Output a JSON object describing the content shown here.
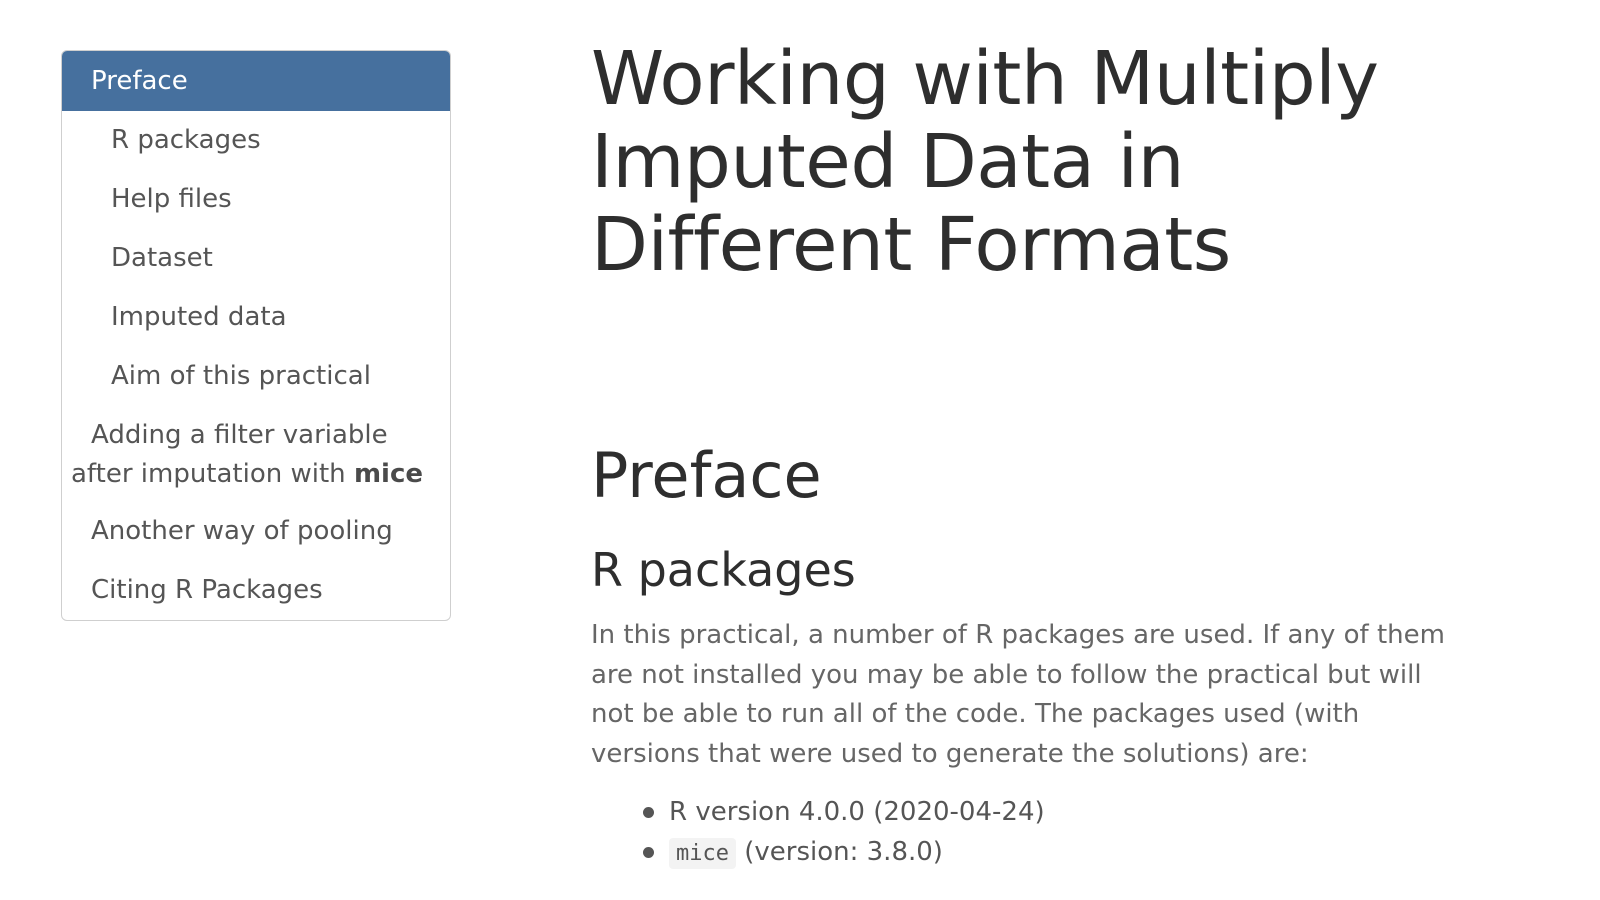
{
  "toc": {
    "items": [
      {
        "label": "Preface"
      },
      {
        "label": "R packages"
      },
      {
        "label": "Help files"
      },
      {
        "label": "Dataset"
      },
      {
        "label": "Imputed data"
      },
      {
        "label": "Aim of this practical"
      },
      {
        "label_part1": "Adding a filter variable",
        "label_part2": "after imputation with ",
        "label_bold": "mice"
      },
      {
        "label": "Another way of pooling"
      },
      {
        "label": "Citing R Packages"
      }
    ]
  },
  "main": {
    "title_line1": "Working with Multiply",
    "title_line2": "Imputed Data in",
    "title_line3": "Different Formats",
    "h1": "Preface",
    "h2": "R packages",
    "paragraph": "In this practical, a number of R packages are used. If any of them are not installed you may be able to follow the practical but will not be able to run all of the code. The packages used (with versions that were used to generate the solutions) are:",
    "packages": [
      {
        "text": "R version 4.0.0 (2020-04-24)"
      },
      {
        "code": "mice",
        "text": " (version: 3.8.0)"
      }
    ]
  }
}
